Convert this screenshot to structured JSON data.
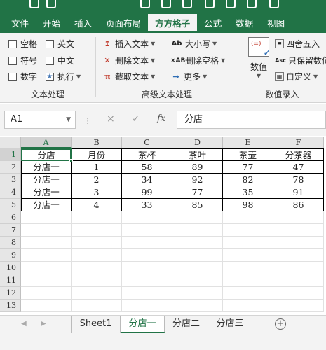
{
  "ribbon_tabs": [
    "文件",
    "开始",
    "插入",
    "页面布局",
    "方方格子",
    "公式",
    "数据",
    "视图"
  ],
  "active_tab": "方方格子",
  "groups": {
    "text": {
      "label": "文本处理",
      "checkboxes": [
        "空格",
        "英文",
        "符号",
        "中文",
        "数字"
      ],
      "execute_label": "执行"
    },
    "advanced": {
      "label": "高级文本处理",
      "items": [
        "插入文本",
        "删除文本",
        "截取文本",
        "大小写",
        "删除空格",
        "更多"
      ]
    },
    "number": {
      "label": "数值录入",
      "big_label": "数值",
      "items": [
        "四舍五入",
        "只保留数值",
        "自定义"
      ]
    }
  },
  "formula_bar": {
    "name_box": "A1",
    "cancel_icon": "×",
    "enter_icon": "✓",
    "fx_label": "fx",
    "content": "分店"
  },
  "columns": [
    "A",
    "B",
    "C",
    "D",
    "E",
    "F"
  ],
  "row_numbers": [
    "1",
    "2",
    "3",
    "4",
    "5",
    "6",
    "7",
    "8",
    "9",
    "10",
    "11",
    "12",
    "13"
  ],
  "table": {
    "header": [
      "分店",
      "月份",
      "茶杯",
      "茶叶",
      "茶壶",
      "分茶器"
    ],
    "rows": [
      [
        "分店一",
        "1",
        "58",
        "89",
        "77",
        "47"
      ],
      [
        "分店一",
        "2",
        "34",
        "92",
        "82",
        "78"
      ],
      [
        "分店一",
        "3",
        "99",
        "77",
        "35",
        "91"
      ],
      [
        "分店一",
        "4",
        "33",
        "85",
        "98",
        "86"
      ]
    ]
  },
  "sheets": [
    "Sheet1",
    "分店一",
    "分店二",
    "分店三"
  ],
  "active_sheet": "分店一",
  "colors": {
    "accent": "#217346",
    "ribbon_bg": "#f3f3f3"
  },
  "icons": [
    "undo-icon",
    "redo-icon",
    "checkbox-icon",
    "star-icon",
    "insert-text-icon",
    "delete-text-icon",
    "extract-text-icon",
    "case-icon",
    "delete-space-icon",
    "arrow-icon",
    "number-entry-icon",
    "round-icon",
    "keep-number-icon",
    "custom-icon",
    "add-sheet-icon"
  ]
}
